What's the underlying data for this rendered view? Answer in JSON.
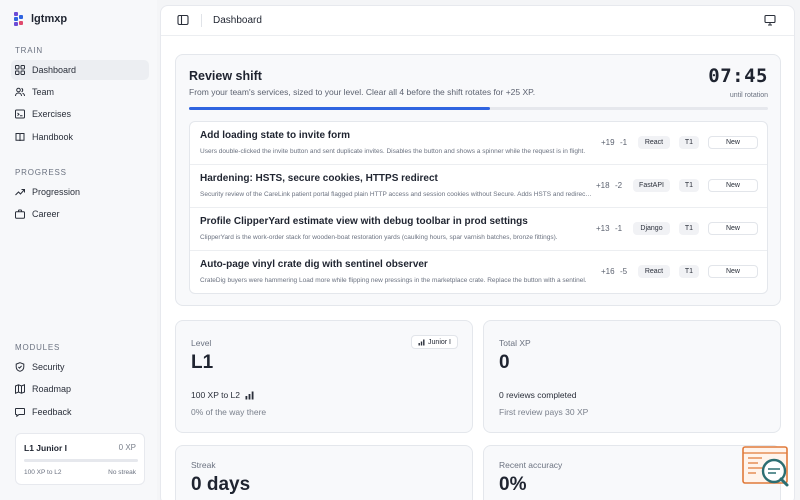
{
  "app": {
    "name": "lgtmxp"
  },
  "sidebar": {
    "sections": {
      "train": "TRAIN",
      "progress": "PROGRESS",
      "modules": "MODULES"
    },
    "items": [
      {
        "label": "Dashboard",
        "icon": "grid-icon"
      },
      {
        "label": "Team",
        "icon": "users-icon"
      },
      {
        "label": "Exercises",
        "icon": "terminal-icon"
      },
      {
        "label": "Handbook",
        "icon": "book-icon"
      },
      {
        "label": "Progression",
        "icon": "trend-icon"
      },
      {
        "label": "Career",
        "icon": "briefcase-icon"
      },
      {
        "label": "Security",
        "icon": "shield-icon"
      },
      {
        "label": "Roadmap",
        "icon": "map-icon"
      },
      {
        "label": "Feedback",
        "icon": "message-icon"
      }
    ],
    "level_card": {
      "title": "L1 Junior I",
      "xp": "0 XP",
      "progress": 0,
      "left_text": "100 XP to L2",
      "right_text": "No streak"
    }
  },
  "topbar": {
    "title": "Dashboard"
  },
  "shift": {
    "title": "Review shift",
    "subtitle": "From your team's services, sized to your level. Clear all 4 before the shift rotates for +25 XP.",
    "timer": "07:45",
    "timer_caption": "until rotation",
    "progress": 0.52
  },
  "tasks": [
    {
      "title": "Add loading state to invite form",
      "desc": "Users double-clicked the invite button and sent duplicate invites. Disables the button and shows a spinner while the request is in flight.",
      "plus": "+19",
      "minus": "-1",
      "framework": "React",
      "tier": "T1",
      "status": "New"
    },
    {
      "title": "Hardening: HSTS, secure cookies, HTTPS redirect",
      "desc": "Security review of the CareLink patient portal flagged plain HTTP access and session cookies without Secure. Adds HSTS and redirects.",
      "plus": "+18",
      "minus": "-2",
      "framework": "FastAPI",
      "tier": "T1",
      "status": "New"
    },
    {
      "title": "Profile ClipperYard estimate view with debug toolbar in prod settings",
      "desc": "ClipperYard is the work-order stack for wooden-boat restoration yards (caulking hours, spar varnish batches, bronze fittings).",
      "plus": "+13",
      "minus": "-1",
      "framework": "Django",
      "tier": "T1",
      "status": "New"
    },
    {
      "title": "Auto-page vinyl crate dig with sentinel observer",
      "desc": "CrateDig buyers were hammering Load more while flipping new pressings in the marketplace crate. Replace the button with a sentinel.",
      "plus": "+16",
      "minus": "-5",
      "framework": "React",
      "tier": "T1",
      "status": "New"
    }
  ],
  "stats": {
    "level": {
      "label": "Level",
      "value": "L1",
      "badge": "Junior I",
      "line1": "100 XP to L2",
      "line2": "0% of the way there"
    },
    "total_xp": {
      "label": "Total XP",
      "value": "0",
      "line1": "0 reviews completed",
      "line2": "First review pays 30 XP"
    },
    "streak": {
      "label": "Streak",
      "value": "0 days"
    },
    "accuracy": {
      "label": "Recent accuracy",
      "value": "0%"
    }
  },
  "colors": {
    "accent": "#2f64e0",
    "helper": "#e07a3a"
  }
}
